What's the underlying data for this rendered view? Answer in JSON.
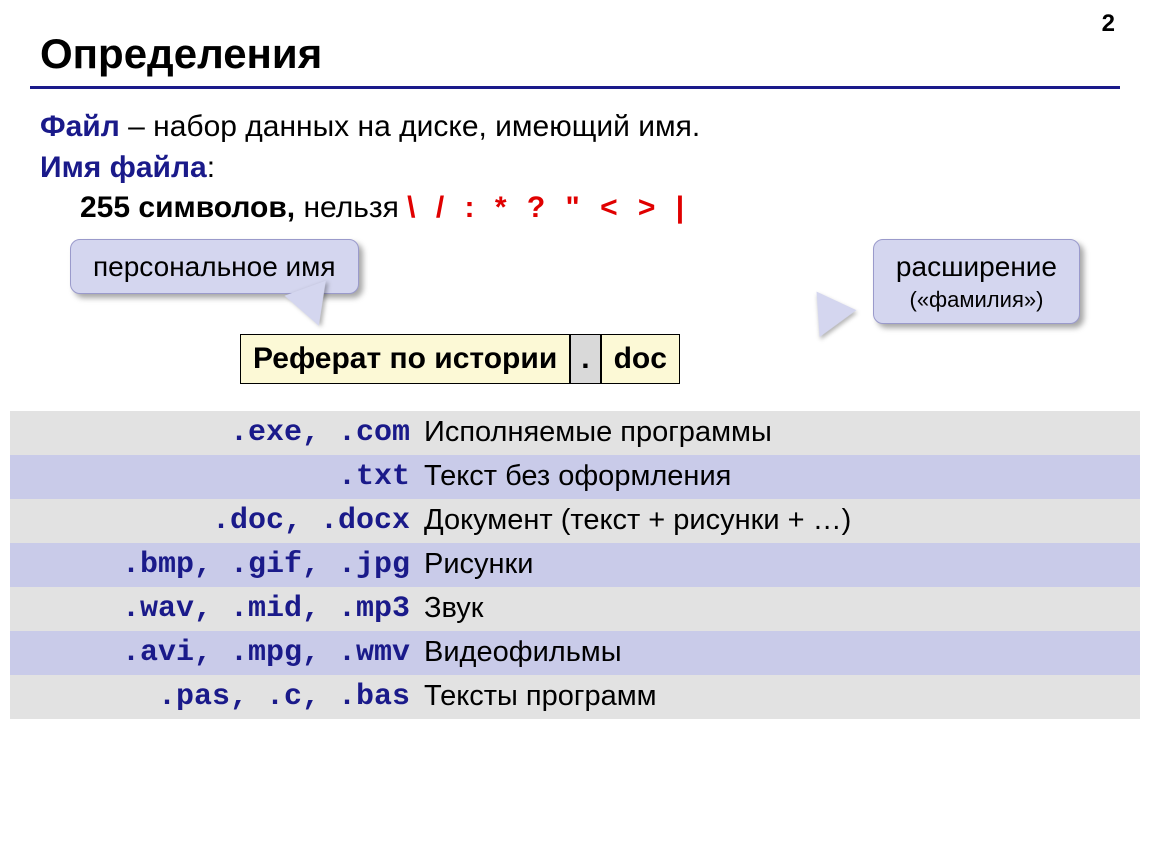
{
  "page_number": "2",
  "title": "Определения",
  "line1": {
    "term": "Файл",
    "rest": " – набор данных на диске, имеющий имя."
  },
  "line2": {
    "term": "Имя файла",
    "colon": ":"
  },
  "line3": {
    "bold": "255 символов,",
    "plain": " нельзя ",
    "forbidden": "\\ / : * ? \" < > |"
  },
  "callouts": {
    "left": "персональное имя",
    "right": "расширение",
    "right_sub": "(«фамилия»)"
  },
  "filename": {
    "name": "Реферат по истории",
    "dot": ".",
    "ext": "doc"
  },
  "rows": [
    {
      "ext": ".exe, .com",
      "desc": "Исполняемые программы"
    },
    {
      "ext": ".txt",
      "desc": "Текст без оформления"
    },
    {
      "ext": ".doc, .docx",
      "desc": "Документ (текст + рисунки + …)"
    },
    {
      "ext": ".bmp, .gif, .jpg",
      "desc": "Рисунки"
    },
    {
      "ext": ".wav, .mid, .mp3",
      "desc": "Звук"
    },
    {
      "ext": ".avi, .mpg, .wmv",
      "desc": "Видеофильмы"
    },
    {
      "ext": ".pas, .c, .bas",
      "desc": "Тексты программ"
    }
  ]
}
